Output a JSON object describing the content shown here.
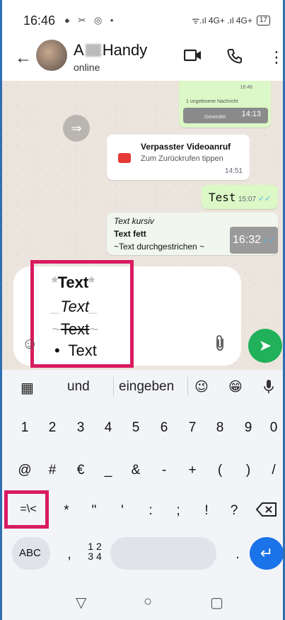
{
  "status_bar": {
    "time": "16:46",
    "icons": "● ✂ ◎ •",
    "network": "ᯤ.ıl 4G+ .ıl 4G+",
    "battery": "17"
  },
  "header": {
    "name_start": "A",
    "name_end": "Handy",
    "status": "online"
  },
  "messages": {
    "top_time": "16:46",
    "unread": "1 ungelesene Nachricht",
    "gesendet": "Gesendet",
    "top_time2": "14:13",
    "missed_call_title": "Verpasster Videoanruf",
    "missed_call_sub": "Zum Zurückrufen tippen",
    "missed_call_time": "14:51",
    "test_text": "Test",
    "test_time": "15:07",
    "quote_italic": "Text kursiv",
    "quote_bold": "Text fett",
    "quote_strike": "~Text durchgestrichen ~",
    "quote_time": "16:32"
  },
  "input": {
    "line1_mark": "*",
    "line1_text": "Text",
    "line2_mark": "_",
    "line2_text": "Text",
    "line3_mark": "~",
    "line3_text": "Text",
    "line4_bullet": "•",
    "line4_text": "Text"
  },
  "suggestions": {
    "word1": "und",
    "word2": "eingeben",
    "emoji1": "😉",
    "emoji2": "😁"
  },
  "keyboard": {
    "row1": [
      "1",
      "2",
      "3",
      "4",
      "5",
      "6",
      "7",
      "8",
      "9",
      "0"
    ],
    "row2": [
      "@",
      "#",
      "€",
      "_",
      "&",
      "-",
      "+",
      "(",
      ")",
      "/"
    ],
    "row3_toggle": "=\\<",
    "row3": [
      "*",
      "\"",
      "'",
      ":",
      ";",
      "!",
      "?"
    ],
    "abc": "ABC",
    "comma": ",",
    "numpad_top": "1 2",
    "numpad_bottom": "3 4"
  },
  "colors": {
    "accent_green": "#20b15a",
    "highlight": "#d81b60",
    "enter_blue": "#1a73e8"
  }
}
